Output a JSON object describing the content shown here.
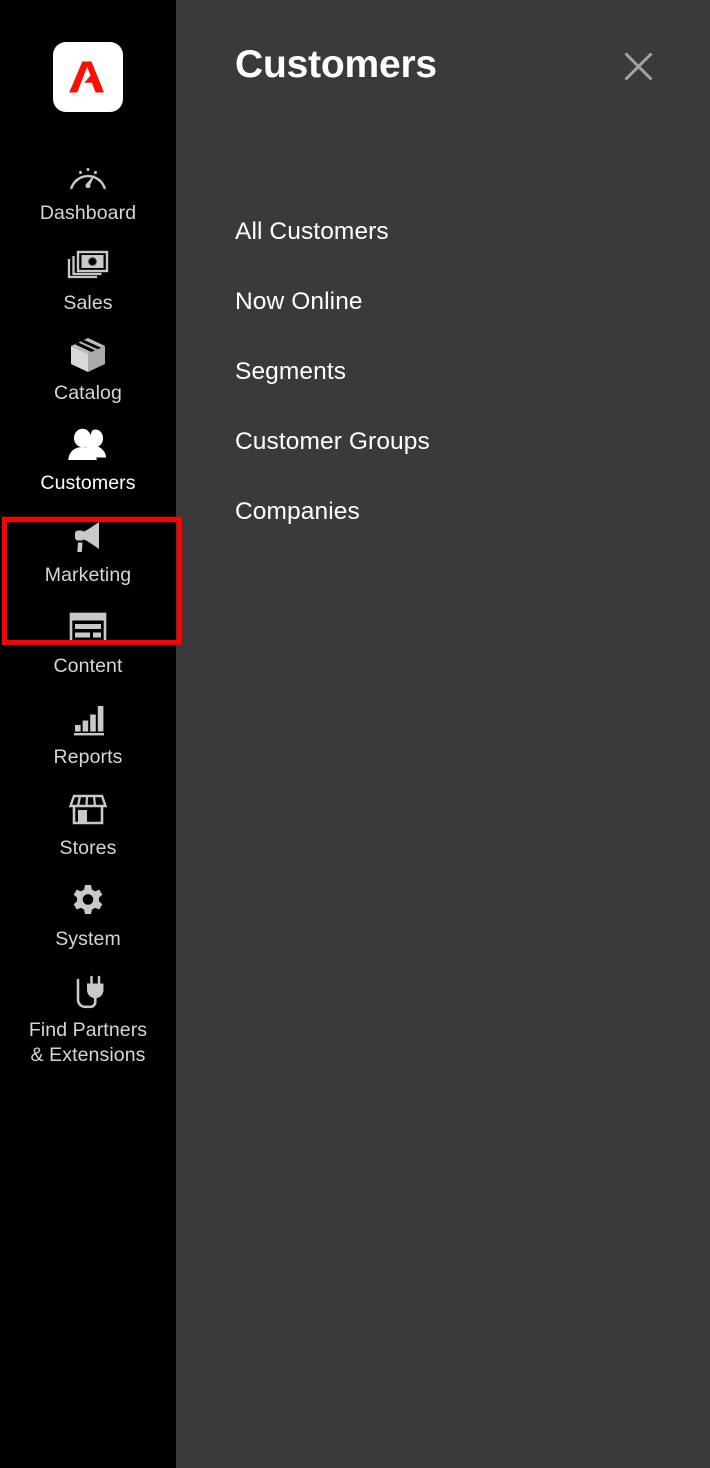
{
  "colors": {
    "sidebar_bg": "#000000",
    "panel_bg": "#3a3a3a",
    "highlight_border": "#ff0000",
    "icon_gray": "#c9c9c9",
    "label_gray": "#d6d6d6",
    "close_icon": "#a8a29a",
    "logo_red": "#fa0f00",
    "logo_plate": "#ffffff"
  },
  "sidebar": {
    "logo": {
      "icon": "adobe-logo-icon",
      "alt": "Adobe"
    },
    "items": [
      {
        "id": "dashboard",
        "label": "Dashboard",
        "icon": "gauge-icon",
        "active": false
      },
      {
        "id": "sales",
        "label": "Sales",
        "icon": "banknotes-icon",
        "active": false
      },
      {
        "id": "catalog",
        "label": "Catalog",
        "icon": "box-icon",
        "active": false
      },
      {
        "id": "customers",
        "label": "Customers",
        "icon": "people-icon",
        "active": true
      },
      {
        "id": "marketing",
        "label": "Marketing",
        "icon": "megaphone-icon",
        "active": false
      },
      {
        "id": "content",
        "label": "Content",
        "icon": "page-layout-icon",
        "active": false
      },
      {
        "id": "reports",
        "label": "Reports",
        "icon": "bar-chart-icon",
        "active": false
      },
      {
        "id": "stores",
        "label": "Stores",
        "icon": "storefront-icon",
        "active": false
      },
      {
        "id": "system",
        "label": "System",
        "icon": "gear-icon",
        "active": false
      },
      {
        "id": "partners",
        "label": "Find Partners\n& Extensions",
        "label_line1": "Find Partners",
        "label_line2": "& Extensions",
        "icon": "plug-icon",
        "active": false
      }
    ]
  },
  "panel": {
    "title": "Customers",
    "close": {
      "icon": "close-icon",
      "label": "Close"
    },
    "menu_items": [
      {
        "id": "all-customers",
        "label": "All Customers"
      },
      {
        "id": "now-online",
        "label": "Now Online"
      },
      {
        "id": "segments",
        "label": "Segments"
      },
      {
        "id": "customer-groups",
        "label": "Customer Groups"
      },
      {
        "id": "companies",
        "label": "Companies"
      }
    ]
  }
}
